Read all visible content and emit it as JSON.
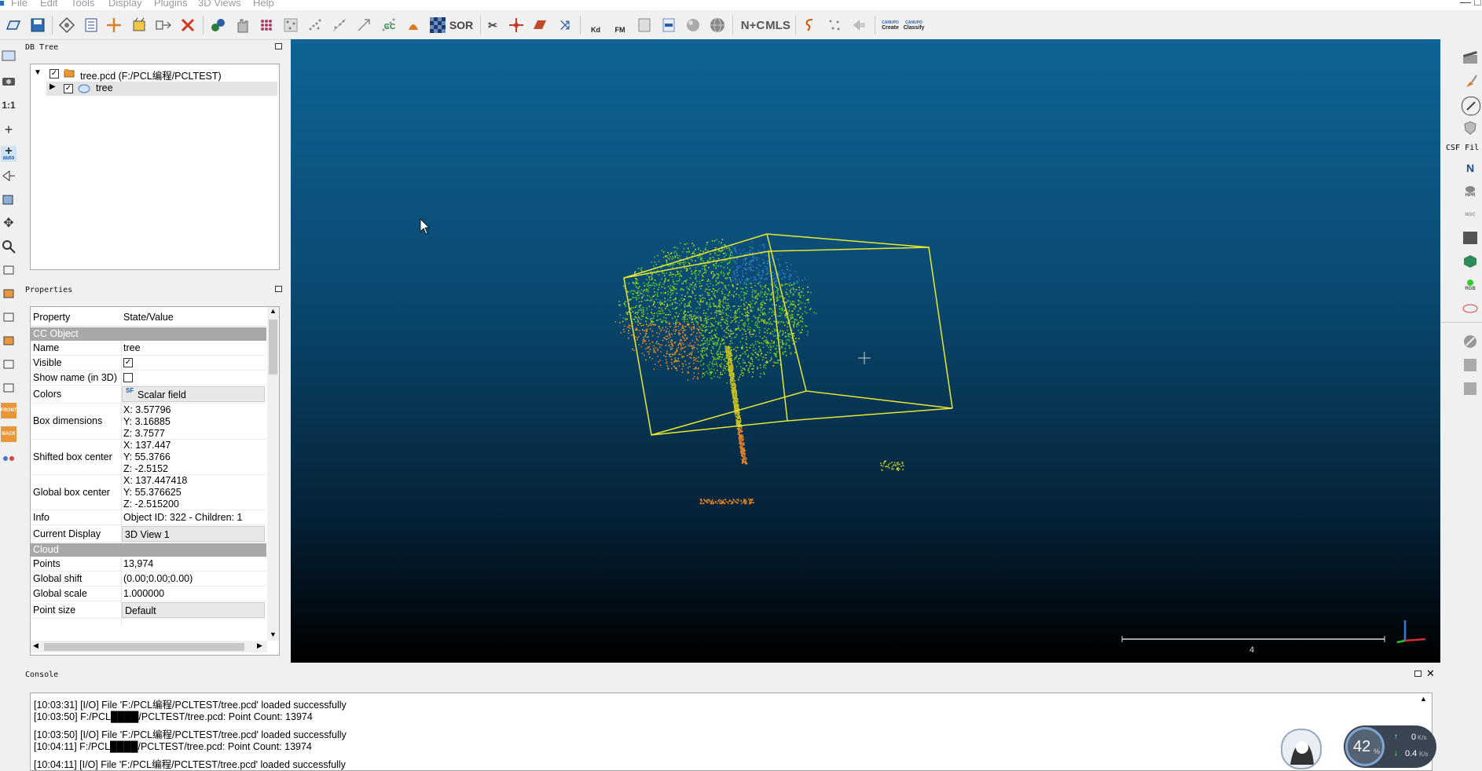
{
  "menu": [
    "File",
    "Edit",
    "Tools",
    "Display",
    "Plugins",
    "3D Views",
    "Help"
  ],
  "window_controls": {
    "minimize": "—",
    "maximize": "□"
  },
  "toolbar": {
    "icons": [
      "open-icon",
      "save-icon",
      "graphical-segmentation-icon",
      "list-icon",
      "translate-rotate-icon",
      "crop-icon",
      "merge-icon",
      "delete-icon",
      "clone-icon",
      "hand-icon",
      "sample-points-icon",
      "subsample-icon",
      "noise-icon",
      "scatter-icon",
      "scale-icon",
      "scatter2-icon",
      "cc-icon",
      "fox-icon",
      "checker-icon",
      "sor-icon",
      "scissors-icon",
      "move-icon",
      "plane-icon",
      "register-icon",
      "kd-icon",
      "fm-icon",
      "export-icon",
      "csv-icon",
      "sphere-icon",
      "globe-icon",
      "ntc-icon",
      "mls-icon",
      "s-icon",
      "points-icon",
      "fade-icon",
      "canupo-create-icon",
      "canupo-classify-icon"
    ],
    "labels": {
      "cc": "CC",
      "sor": "SOR",
      "kd": "Kd",
      "fm": "FM",
      "ntc": "N+C",
      "mls": "MLS",
      "canupo": "CANUPO",
      "create": "Create",
      "classify": "Classify"
    }
  },
  "left_tools": {
    "one_to_one": "1:1",
    "auto": "auto",
    "front": "FRONT",
    "back": "BACK"
  },
  "right_tools": {
    "csf_label": "CSF Fil",
    "north": "N",
    "hpr": "HPR",
    "msc": "MSC",
    "rgb": "RGB"
  },
  "db_tree": {
    "title": "DB Tree",
    "file_item": "tree.pcd (F:/PCL编程/PCLTEST)",
    "child_item": "tree"
  },
  "properties": {
    "title": "Properties",
    "header": {
      "property": "Property",
      "value": "State/Value"
    },
    "section_object": "CC Object",
    "name_label": "Name",
    "name_value": "tree",
    "visible_label": "Visible",
    "visible_check": "✓",
    "show_name_label": "Show name (in 3D)",
    "colors_label": "Colors",
    "colors_value": "Scalar field",
    "colors_icon": "SF",
    "box_dim_label": "Box dimensions",
    "box_dim_x": "X: 3.57796",
    "box_dim_y": "Y: 3.16885",
    "box_dim_z": "Z: 3.7577",
    "shifted_center_label": "Shifted box center",
    "shifted_x": "X: 137.447",
    "shifted_y": "Y: 55.3766",
    "shifted_z": "Z: -2.5152",
    "global_center_label": "Global box center",
    "global_x": "X: 137.447418",
    "global_y": "Y: 55.376625",
    "global_z": "Z: -2.515200",
    "info_label": "Info",
    "info_value": "Object ID: 322 - Children: 1",
    "current_display_label": "Current Display",
    "current_display_value": "3D View 1",
    "section_cloud": "Cloud",
    "points_label": "Points",
    "points_value": "13,974",
    "global_shift_label": "Global shift",
    "global_shift_value": "(0.00;0.00;0.00)",
    "global_scale_label": "Global scale",
    "global_scale_value": "1.000000",
    "point_size_label": "Point size",
    "point_size_value": "Default"
  },
  "view": {
    "scale_label": "4"
  },
  "console": {
    "title": "Console",
    "lines": [
      "[10:03:31] [I/O] File 'F:/PCL编程/PCLTEST/tree.pcd' loaded successfully",
      "[10:03:50] F:/PCL████/PCLTEST/tree.pcd: Point Count: 13974",
      "[10:03:50] [I/O] File 'F:/PCL编程/PCLTEST/tree.pcd' loaded successfully",
      "[10:04:11] F:/PCL████/PCLTEST/tree.pcd: Point Count: 13974",
      "[10:04:11] [I/O] File 'F:/PCL编程/PCLTEST/tree.pcd' loaded successfully"
    ]
  },
  "network_widget": {
    "percent": "42",
    "percent_unit": "%",
    "up": "0",
    "down": "0.4",
    "rate_unit": "K/s",
    "up_arrow": "↑",
    "down_arrow": "↓"
  },
  "colors": {
    "accent_yellow": "#e8e830",
    "tree_green": "#4ec02a",
    "tree_orange": "#e0802a",
    "tree_blue": "#3468c8"
  }
}
